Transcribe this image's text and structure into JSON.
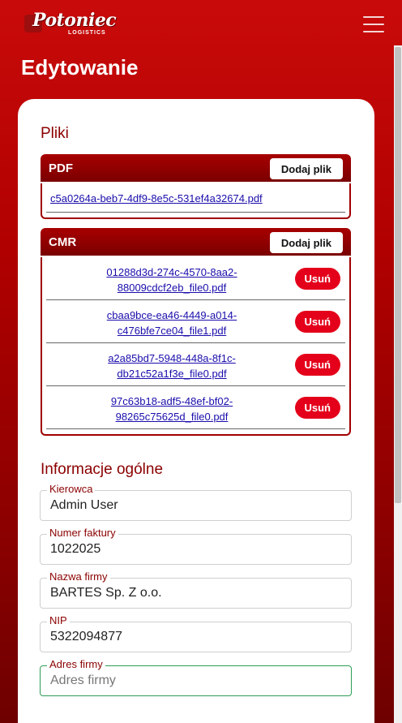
{
  "header": {
    "logo_main": "Potoniec",
    "logo_sub": "LOGISTICS",
    "page_title": "Edytowanie"
  },
  "files_section": {
    "title": "Pliki",
    "pdf": {
      "label": "PDF",
      "add_label": "Dodaj plik",
      "file": "c5a0264a-beb7-4df9-8e5c-531ef4a32674.pdf"
    },
    "cmr": {
      "label": "CMR",
      "add_label": "Dodaj plik",
      "delete_label": "Usuń",
      "files": [
        {
          "line1": "01288d3d-274c-4570-8aa2-",
          "line2": "88009cdcf2eb_file0.pdf"
        },
        {
          "line1": "cbaa9bce-ea46-4449-a014-",
          "line2": "c476bfe7ce04_file1.pdf"
        },
        {
          "line1": "a2a85bd7-5948-448a-8f1c-",
          "line2": "db21c52a1f3e_file0.pdf"
        },
        {
          "line1": "97c63b18-adf5-48ef-bf02-",
          "line2": "98265c75625d_file0.pdf"
        }
      ]
    }
  },
  "general_section": {
    "title": "Informacje ogólne",
    "fields": {
      "driver": {
        "label": "Kierowca",
        "value": "Admin User"
      },
      "invoice": {
        "label": "Numer faktury",
        "value": "1022025"
      },
      "company": {
        "label": "Nazwa firmy",
        "value": "BARTES Sp. Z o.o."
      },
      "nip": {
        "label": "NIP",
        "value": "5322094877"
      },
      "address": {
        "label": "Adres firmy",
        "value": "",
        "placeholder": "Adres firmy"
      }
    }
  },
  "colors": {
    "brand_red": "#c90a0a",
    "section_title": "#8b0000",
    "delete_button": "#e4001a",
    "focus_border": "#2e9d57",
    "link": "#1a0dab"
  }
}
